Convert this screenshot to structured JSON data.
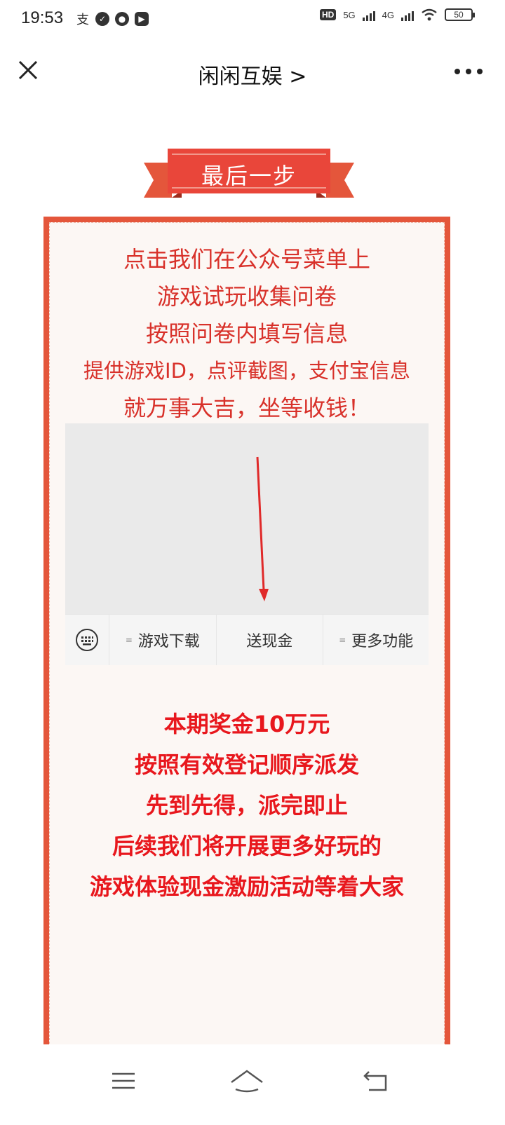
{
  "status_bar": {
    "time": "19:53",
    "hd_label": "HD",
    "network_5g": "5G",
    "network_4g": "4G",
    "battery": "50",
    "icons": [
      "alipay-icon",
      "check-circle-icon",
      "chat-bubble-icon",
      "play-icon",
      "wifi-icon"
    ]
  },
  "navbar": {
    "title": "闲闲互娱 >",
    "close_icon": "close-icon",
    "more_icon": "more-icon"
  },
  "banner": {
    "label": "最后一步"
  },
  "intro": {
    "line1": "点击我们在公众号菜单上",
    "line2": "游戏试玩收集问卷",
    "line3": "按照问卷内填写信息",
    "line4": "提供游戏ID，点评截图，支付宝信息",
    "line5": "就万事大吉，坐等收钱！"
  },
  "menu": {
    "item1": "游戏下载",
    "item2": "送现金",
    "item3": "更多功能",
    "keyboard_icon": "keyboard-icon"
  },
  "bonus": {
    "text": "本期奖金10万元\n按照有效登记顺序派发\n先到先得，派完即止\n后续我们将开展更多好玩的\n游戏体验现金激励活动等着大家"
  },
  "bottom_nav": {
    "icons": [
      "menu-icon",
      "home-icon",
      "back-icon"
    ]
  },
  "colors": {
    "accent_red": "#e4563b",
    "text_red": "#d8312a",
    "bonus_red": "#e8171d",
    "card_bg": "#fcf7f4"
  }
}
